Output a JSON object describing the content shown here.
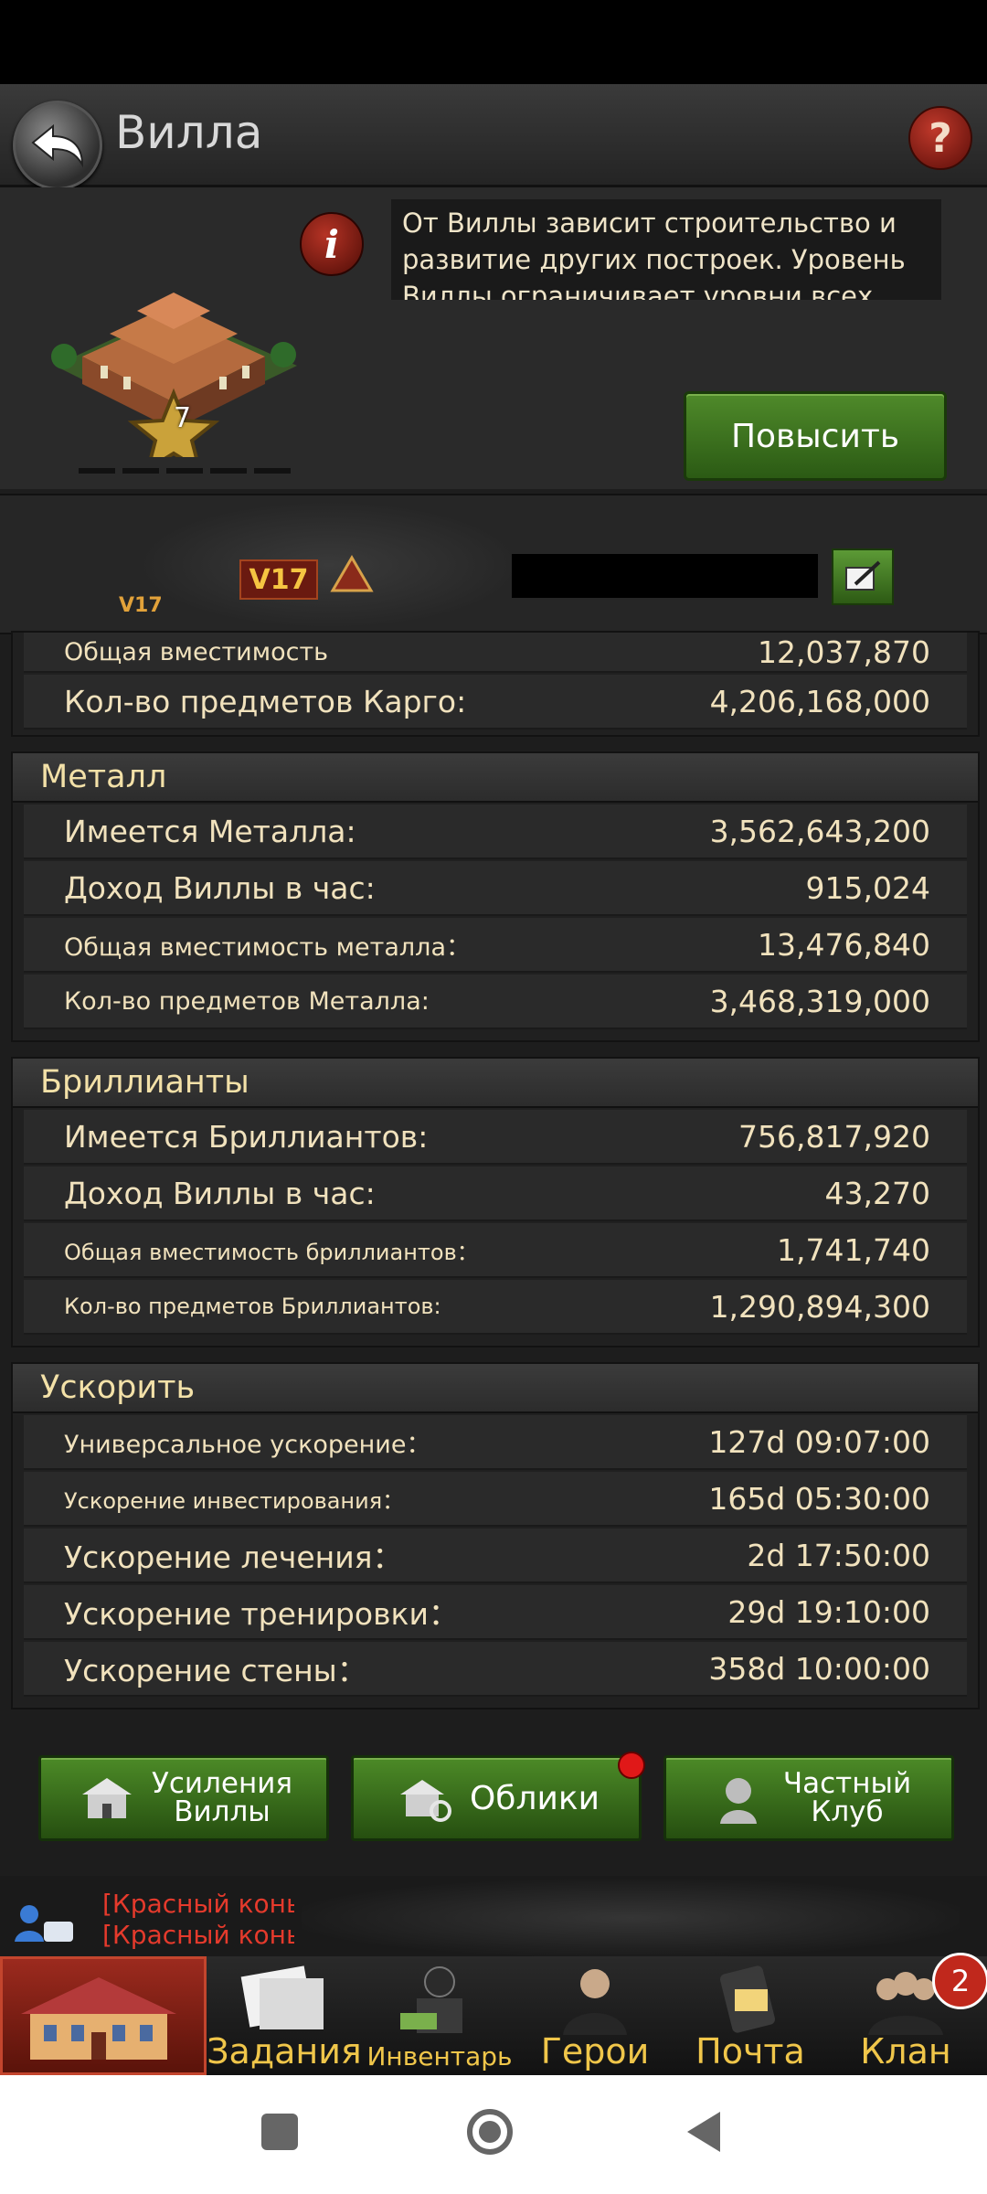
{
  "header": {
    "title": "Вилла",
    "help_label": "?"
  },
  "villa": {
    "level": "7",
    "info_label": "i",
    "description": "От Виллы зависит строительство и развитие других построек. Уровень Виллы ограничивает уровни всех",
    "upgrade_label": "Повысить"
  },
  "player": {
    "vip_label": "V17",
    "vip_label_small": "V17"
  },
  "cargo": {
    "rows": [
      {
        "label": "Общая вместимость",
        "value": "12,037,870"
      },
      {
        "label": "Кол-во предметов Карго:",
        "value": "4,206,168,000"
      }
    ]
  },
  "metal": {
    "title": "Металл",
    "rows": [
      {
        "label": "Имеется Металла:",
        "value": "3,562,643,200"
      },
      {
        "label": "Доход Виллы в час:",
        "value": "915,024"
      },
      {
        "label": "Общая вместимость металла：",
        "value": "13,476,840"
      },
      {
        "label": "Кол-во предметов Металла:",
        "value": "3,468,319,000"
      }
    ]
  },
  "diamonds": {
    "title": "Бриллианты",
    "rows": [
      {
        "label": "Имеется Бриллиантов:",
        "value": "756,817,920"
      },
      {
        "label": "Доход Виллы в час:",
        "value": "43,270"
      },
      {
        "label": "Общая вместимость бриллиантов：",
        "value": "1,741,740"
      },
      {
        "label": "Кол-во предметов Бриллиантов:",
        "value": "1,290,894,300"
      }
    ]
  },
  "speedup": {
    "title": "Ускорить",
    "rows": [
      {
        "label": "Универсальное ускорение：",
        "value": "127d 09:07:00"
      },
      {
        "label": "Ускорение инвестирования：",
        "value": "165d 05:30:00"
      },
      {
        "label": "Ускорение лечения：",
        "value": "2d 17:50:00"
      },
      {
        "label": "Ускорение тренировки：",
        "value": "29d 19:10:00"
      },
      {
        "label": "Ускорение стены：",
        "value": "358d 10:00:00"
      }
    ]
  },
  "buttons": {
    "boosts_line1": "Усиления",
    "boosts_line2": "Виллы",
    "skins": "Облики",
    "club_line1": "Частный",
    "club_line2": "Клуб"
  },
  "chat": {
    "line1": "[Красный конь к",
    "line2": "[Красный конь"
  },
  "nav": {
    "quests": "Задания",
    "inventory": "Инвентарь",
    "heroes": "Герои",
    "mail": "Почта",
    "clan": "Клан",
    "clan_badge": "2"
  },
  "colors": {
    "accent_green": "#3f7a1f",
    "label_gold": "#f0c64a",
    "alert_red": "#e01818"
  }
}
